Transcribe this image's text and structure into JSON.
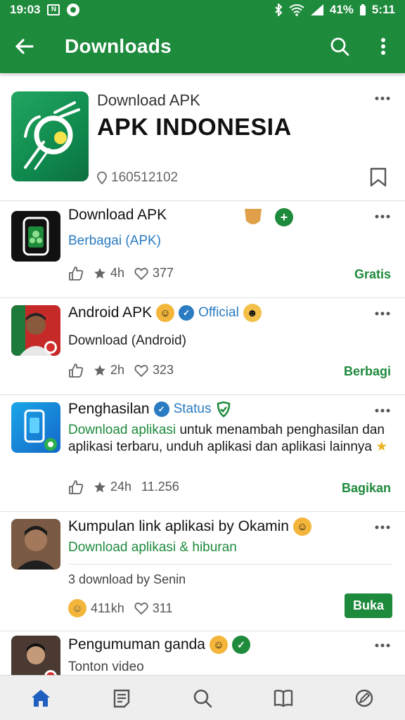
{
  "status_bar": {
    "time": "19:03",
    "battery": "41%",
    "clock_right": "5:11"
  },
  "app_bar": {
    "title": "Downloads"
  },
  "hero": {
    "subtitle": "Download APK",
    "title": "APK INDONESIA",
    "meta": "160512102"
  },
  "items": [
    {
      "title": "Download APK",
      "subtitle": "Berbagai (APK)",
      "stats": {
        "stars": "4h",
        "likes": "377"
      },
      "action": "Gratis"
    },
    {
      "title": "Android APK",
      "badge": "Official",
      "subtitle": "Download (Android)",
      "stats": {
        "stars": "2h",
        "likes": "323"
      },
      "action": "Berbagi"
    },
    {
      "title": "Penghasilan",
      "badge": "Status",
      "description_green": "Download aplikasi",
      "description": "untuk menambah penghasilan dan aplikasi terbaru, unduh aplikasi dan aplikasi lainnya",
      "stats": {
        "stars": "24h",
        "likes": "11.256"
      },
      "action": "Bagikan"
    },
    {
      "title": "Kumpulan link aplikasi by Okamin",
      "subtitle": "Download aplikasi & hiburan",
      "extra": "3 download by Senin",
      "stats": {
        "stars": "411kh",
        "likes": "311"
      },
      "action": "Buka"
    },
    {
      "title": "Pengumuman ganda",
      "subtitle": "Tonton video"
    }
  ],
  "icons": {
    "back": "arrow-left-icon",
    "search": "search-icon",
    "more": "more-vert-icon",
    "home": "home-icon",
    "news": "news-icon",
    "explore": "search-icon",
    "library": "book-icon",
    "settings": "edit-icon"
  },
  "colors": {
    "primary": "#1e8a3c",
    "link_blue": "#2a7bc2"
  }
}
